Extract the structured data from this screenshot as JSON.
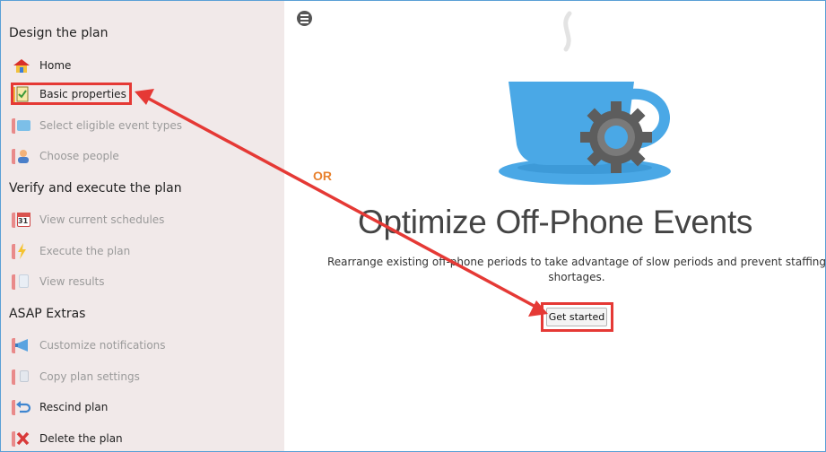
{
  "sidebar": {
    "sections": [
      {
        "title": "Design the plan"
      },
      {
        "title": "Verify and execute the plan"
      },
      {
        "title": "ASAP Extras"
      }
    ],
    "items": [
      {
        "label": "Home",
        "icon": "home-icon",
        "enabled": true
      },
      {
        "label": "Basic properties",
        "icon": "checklist-icon",
        "enabled": true
      },
      {
        "label": "Select eligible event types",
        "icon": "event-types-icon",
        "enabled": false
      },
      {
        "label": "Choose people",
        "icon": "person-icon",
        "enabled": false
      },
      {
        "label": "View current schedules",
        "icon": "calendar-icon",
        "enabled": false,
        "badge": "31"
      },
      {
        "label": "Execute the plan",
        "icon": "lightning-icon",
        "enabled": false
      },
      {
        "label": "View results",
        "icon": "document-icon",
        "enabled": false
      },
      {
        "label": "Customize notifications",
        "icon": "megaphone-icon",
        "enabled": false
      },
      {
        "label": "Copy plan settings",
        "icon": "copy-icon",
        "enabled": false
      },
      {
        "label": "Rescind plan",
        "icon": "undo-arrow-icon",
        "enabled": true
      },
      {
        "label": "Delete the plan",
        "icon": "delete-x-icon",
        "enabled": true
      }
    ]
  },
  "main": {
    "or_label": "OR",
    "title": "Optimize Off-Phone Events",
    "subtitle": "Rearrange existing off-phone periods to take advantage of slow periods and prevent staffing shortages.",
    "get_started_label": "Get started"
  },
  "colors": {
    "accent_red": "#e53935",
    "or_orange": "#e8812d",
    "cup_blue": "#4aa8e6",
    "sidebar_bg": "#f1e9e9"
  }
}
